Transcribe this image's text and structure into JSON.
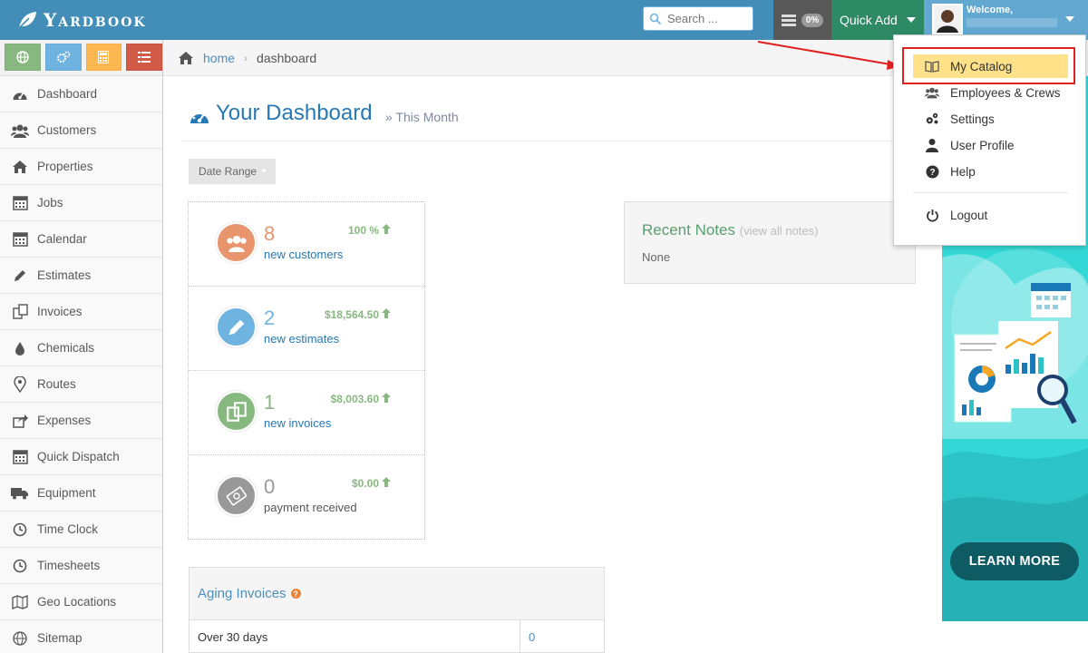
{
  "brand": {
    "name": "Yardbook"
  },
  "topbar": {
    "search_placeholder": "Search ...",
    "tasks_badge": "0%",
    "quick_add_label": "Quick Add",
    "welcome_label": "Welcome,"
  },
  "sidebar": {
    "shortcut_colors": [
      "#87b87f",
      "#6fb3e0",
      "#ffb752",
      "#d15b47"
    ],
    "items": [
      {
        "label": "Dashboard",
        "icon": "dashboard-icon"
      },
      {
        "label": "Customers",
        "icon": "users-icon"
      },
      {
        "label": "Properties",
        "icon": "home-icon"
      },
      {
        "label": "Jobs",
        "icon": "calendar-icon"
      },
      {
        "label": "Calendar",
        "icon": "calendar-icon"
      },
      {
        "label": "Estimates",
        "icon": "pencil-icon"
      },
      {
        "label": "Invoices",
        "icon": "copy-icon"
      },
      {
        "label": "Chemicals",
        "icon": "tint-icon"
      },
      {
        "label": "Routes",
        "icon": "map-marker-icon"
      },
      {
        "label": "Expenses",
        "icon": "share-icon"
      },
      {
        "label": "Quick Dispatch",
        "icon": "calendar-icon"
      },
      {
        "label": "Equipment",
        "icon": "truck-icon"
      },
      {
        "label": "Time Clock",
        "icon": "clock-icon"
      },
      {
        "label": "Timesheets",
        "icon": "clock-icon"
      },
      {
        "label": "Geo Locations",
        "icon": "map-icon"
      },
      {
        "label": "Sitemap",
        "icon": "globe-icon"
      }
    ]
  },
  "breadcrumb": {
    "home": "home",
    "current": "dashboard"
  },
  "header": {
    "title": "Your Dashboard",
    "subtitle": "» This Month"
  },
  "date_range": {
    "label": "Date Range"
  },
  "stats": [
    {
      "value": "8",
      "label": "new customers",
      "change": "100 %",
      "color": "#e8956d",
      "label_color": "#2679b5",
      "icon": "users-icon"
    },
    {
      "value": "2",
      "label": "new estimates",
      "change": "$18,564.50",
      "color": "#6fb3e0",
      "label_color": "#2679b5",
      "icon": "pencil-icon"
    },
    {
      "value": "1",
      "label": "new invoices",
      "change": "$8,003.60",
      "color": "#87b87f",
      "label_color": "#2679b5",
      "icon": "copy-icon"
    },
    {
      "value": "0",
      "label": "payment received",
      "change": "$0.00",
      "color": "#999999",
      "label_color": "#555555",
      "icon": "money-icon"
    }
  ],
  "recent_notes": {
    "title": "Recent Notes",
    "link": "(view all notes)",
    "body": "None"
  },
  "aging_invoices": {
    "title": "Aging Invoices",
    "rows": [
      {
        "label": "Over 30 days",
        "value": "0"
      }
    ]
  },
  "ad": {
    "cta": "LEARN MORE"
  },
  "user_menu": {
    "items": [
      {
        "label": "My Catalog",
        "icon": "book-icon",
        "highlighted": true
      },
      {
        "label": "Employees & Crews",
        "icon": "users-icon"
      },
      {
        "label": "Settings",
        "icon": "cogs-icon"
      },
      {
        "label": "User Profile",
        "icon": "user-icon"
      },
      {
        "label": "Help",
        "icon": "question-circle-icon"
      },
      {
        "label": "Logout",
        "icon": "power-icon"
      }
    ]
  }
}
